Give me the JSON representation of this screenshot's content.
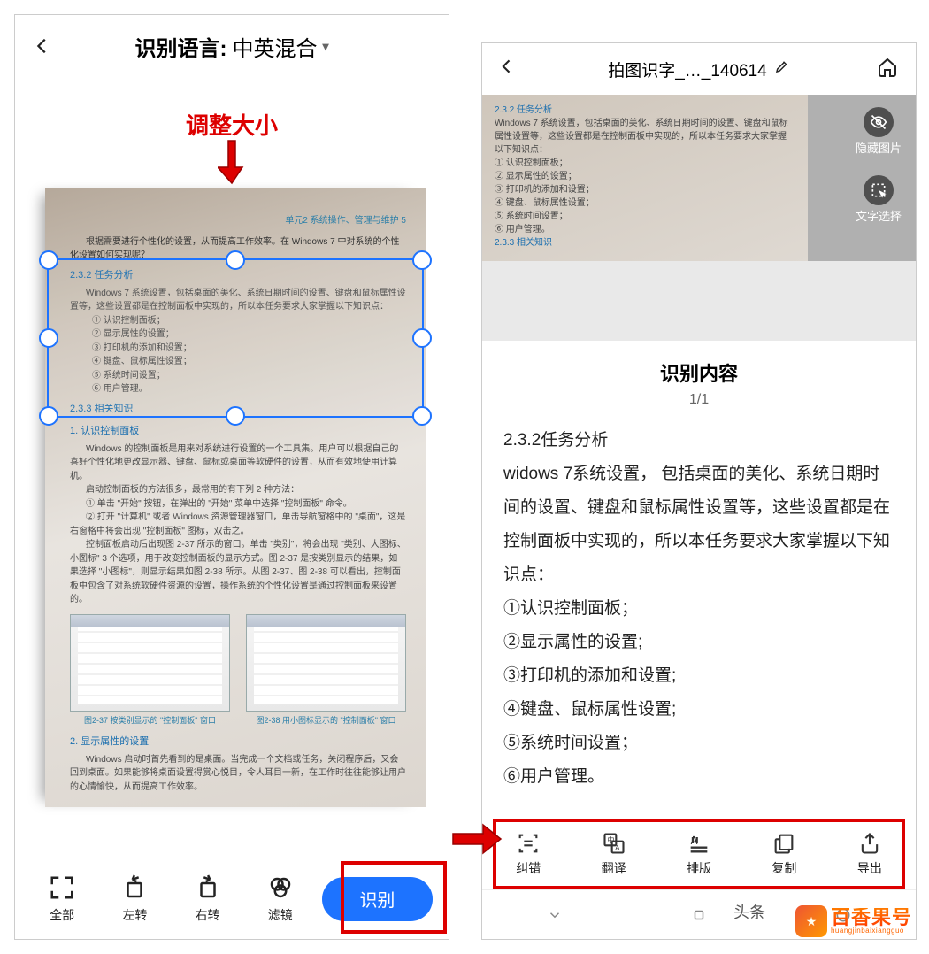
{
  "left": {
    "header": {
      "language_label": "识别语言:",
      "language_value": "中英混合"
    },
    "annotation": "调整大小",
    "document": {
      "topline": "单元2  系统操作、管理与维护    5",
      "p1": "根据需要进行个性化的设置，从而提高工作效率。在 Windows 7 中对系统的个性化设置如何实现呢？",
      "sec232": "2.3.2  任务分析",
      "para232": "Windows 7 系统设置，包括桌面的美化、系统日期时间的设置、键盘和鼠标属性设置等，这些设置都是在控制面板中实现的，所以本任务要求大家掌握以下知识点：",
      "item1": "① 认识控制面板；",
      "item2": "② 显示属性的设置；",
      "item3": "③ 打印机的添加和设置；",
      "item4": "④ 键盘、鼠标属性设置；",
      "item5": "⑤ 系统时间设置；",
      "item6": "⑥ 用户管理。",
      "sec233": "2.3.3  相关知识",
      "sub1_title": "1.  认识控制面板",
      "sub1_p1": "Windows 的控制面板是用来对系统进行设置的一个工具集。用户可以根据自己的喜好个性化地更改显示器、键盘、鼠标或桌面等软硬件的设置，从而有效地使用计算机。",
      "sub1_p2": "启动控制面板的方法很多，最常用的有下列 2 种方法：",
      "sub1_m1": "① 单击 \"开始\" 按钮，在弹出的 \"开始\" 菜单中选择 \"控制面板\" 命令。",
      "sub1_m2": "② 打开 \"计算机\" 或者 Windows 资源管理器窗口，单击导航窗格中的 \"桌面\"，这是右窗格中将会出现 \"控制面板\" 图标，双击之。",
      "sub1_p3": "控制面板启动后出现图 2-37 所示的窗口。单击 \"类别\"，将会出现 \"类别、大图标、小图标\" 3 个选项，用于改变控制面板的显示方式。图 2-37 是按类别显示的结果，如果选择 \"小图标\"，则显示结果如图 2-38 所示。从图 2-37、图 2-38 可以看出，控制面板中包含了对系统软硬件资源的设置，操作系统的个性化设置是通过控制面板来设置的。",
      "cap1": "图2-37  按类别显示的 \"控制面板\" 窗口",
      "cap2": "图2-38  用小图标显示的 \"控制面板\" 窗口",
      "sub2_title": "2.  显示属性的设置",
      "sub2_p1": "Windows 启动时首先看到的是桌面。当完成一个文档或任务，关闭程序后，又会回到桌面。如果能够将桌面设置得赏心悦目，令人耳目一新，在工作时往往能够让用户的心情愉快，从而提高工作效率。"
    },
    "toolbar": {
      "all": "全部",
      "rotate_left": "左转",
      "rotate_right": "右转",
      "filter": "滤镜",
      "recognize": "识别"
    }
  },
  "right": {
    "header": {
      "title": "拍图识字_…_140614"
    },
    "side": {
      "hide_image": "隐藏图片",
      "text_select": "文字选择"
    },
    "preview": {
      "sec232": "2.3.2  任务分析",
      "para232": "Windows 7 系统设置，包括桌面的美化、系统日期时间的设置、键盘和鼠标属性设置等，这些设置都是在控制面板中实现的，所以本任务要求大家掌握以下知识点：",
      "i1": "① 认识控制面板；",
      "i2": "② 显示属性的设置；",
      "i3": "③ 打印机的添加和设置；",
      "i4": "④ 键盘、鼠标属性设置；",
      "i5": "⑤ 系统时间设置；",
      "i6": "⑥ 用户管理。",
      "sec233": "2.3.3  相关知识"
    },
    "content": {
      "title": "识别内容",
      "pager": "1/1",
      "p1": "2.3.2任务分析",
      "p2": "widows 7系统设置， 包括桌面的美化、系统日期时间的设置、键盘和鼠标属性设置等，这些设置都是在控制面板中实现的，所以本任务要求大家掌握以下知识点：",
      "p3": "①认识控制面板；",
      "p4": "②显示属性的设置;",
      "p5": "③打印机的添加和设置;",
      "p6": "④键盘、鼠标属性设置;",
      "p7": "⑤系统时间设置；",
      "p8": "⑥用户管理。"
    },
    "toolbar": {
      "correct": "纠错",
      "translate": "翻译",
      "layout": "排版",
      "copy": "复制",
      "export": "导出"
    },
    "nav_hint": "头条",
    "brand": {
      "zh": "百香果号",
      "py": "huangjinbaixiangguo"
    }
  }
}
